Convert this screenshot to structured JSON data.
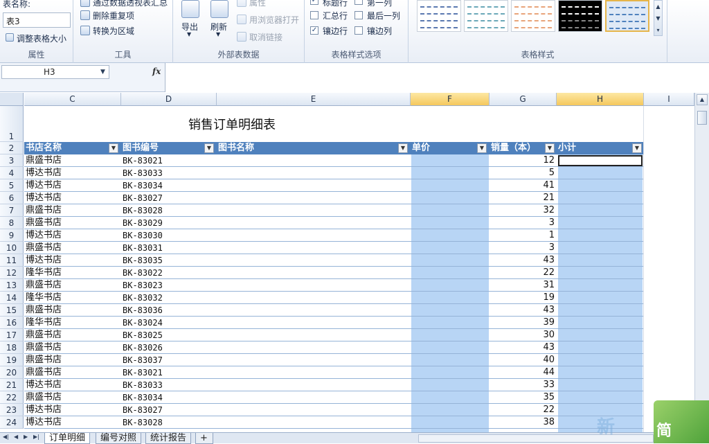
{
  "ribbon": {
    "properties": {
      "table_name_label": "表名称:",
      "table_name_value": "表3",
      "resize_table": "调整表格大小",
      "group_label": "属性"
    },
    "tools": {
      "summarize_pivot": "通过数据透视表汇总",
      "remove_duplicates": "删除重复项",
      "convert_to_range": "转换为区域",
      "group_label": "工具"
    },
    "external": {
      "export": "导出",
      "refresh": "刷新",
      "properties": "属性",
      "open_in_browser": "用浏览器打开",
      "unlink": "取消链接",
      "group_label": "外部表数据"
    },
    "style_options": {
      "header_row": "标题行",
      "first_column": "第一列",
      "total_row": "汇总行",
      "last_column": "最后一列",
      "banded_rows": "镶边行",
      "banded_columns": "镶边列",
      "group_label": "表格样式选项"
    },
    "styles": {
      "group_label": "表格样式",
      "swatch_colors": [
        "#5a78b0",
        "#6aa8b8",
        "#e8a47a",
        "#000000",
        "#4f81bd"
      ]
    }
  },
  "formula_bar": {
    "name_box": "H3",
    "fx": "fx",
    "formula": ""
  },
  "columns": [
    "C",
    "D",
    "E",
    "F",
    "G",
    "H",
    "I"
  ],
  "sheet": {
    "title": "销售订单明细表",
    "headers": [
      "书店名称",
      "图书编号",
      "图书名称",
      "单价",
      "销量（本）",
      "小计"
    ],
    "rows": [
      {
        "n": "3",
        "store": "鼎盛书店",
        "code": "BK-83021",
        "qty": "12"
      },
      {
        "n": "4",
        "store": "博达书店",
        "code": "BK-83033",
        "qty": "5"
      },
      {
        "n": "5",
        "store": "博达书店",
        "code": "BK-83034",
        "qty": "41"
      },
      {
        "n": "6",
        "store": "博达书店",
        "code": "BK-83027",
        "qty": "21"
      },
      {
        "n": "7",
        "store": "鼎盛书店",
        "code": "BK-83028",
        "qty": "32"
      },
      {
        "n": "8",
        "store": "鼎盛书店",
        "code": "BK-83029",
        "qty": "3"
      },
      {
        "n": "9",
        "store": "博达书店",
        "code": "BK-83030",
        "qty": "1"
      },
      {
        "n": "10",
        "store": "鼎盛书店",
        "code": "BK-83031",
        "qty": "3"
      },
      {
        "n": "11",
        "store": "博达书店",
        "code": "BK-83035",
        "qty": "43"
      },
      {
        "n": "12",
        "store": "隆华书店",
        "code": "BK-83022",
        "qty": "22"
      },
      {
        "n": "13",
        "store": "鼎盛书店",
        "code": "BK-83023",
        "qty": "31"
      },
      {
        "n": "14",
        "store": "隆华书店",
        "code": "BK-83032",
        "qty": "19"
      },
      {
        "n": "15",
        "store": "鼎盛书店",
        "code": "BK-83036",
        "qty": "43"
      },
      {
        "n": "16",
        "store": "隆华书店",
        "code": "BK-83024",
        "qty": "39"
      },
      {
        "n": "17",
        "store": "鼎盛书店",
        "code": "BK-83025",
        "qty": "30"
      },
      {
        "n": "18",
        "store": "鼎盛书店",
        "code": "BK-83026",
        "qty": "43"
      },
      {
        "n": "19",
        "store": "鼎盛书店",
        "code": "BK-83037",
        "qty": "40"
      },
      {
        "n": "20",
        "store": "鼎盛书店",
        "code": "BK-83021",
        "qty": "44"
      },
      {
        "n": "21",
        "store": "博达书店",
        "code": "BK-83033",
        "qty": "33"
      },
      {
        "n": "22",
        "store": "鼎盛书店",
        "code": "BK-83034",
        "qty": "35"
      },
      {
        "n": "23",
        "store": "博达书店",
        "code": "BK-83027",
        "qty": "22"
      },
      {
        "n": "24",
        "store": "博达书店",
        "code": "BK-83028",
        "qty": "38"
      }
    ]
  },
  "tabs": {
    "items": [
      "订单明细",
      "编号对照",
      "统计报告"
    ]
  },
  "logo_text": "简",
  "watermark": "新"
}
